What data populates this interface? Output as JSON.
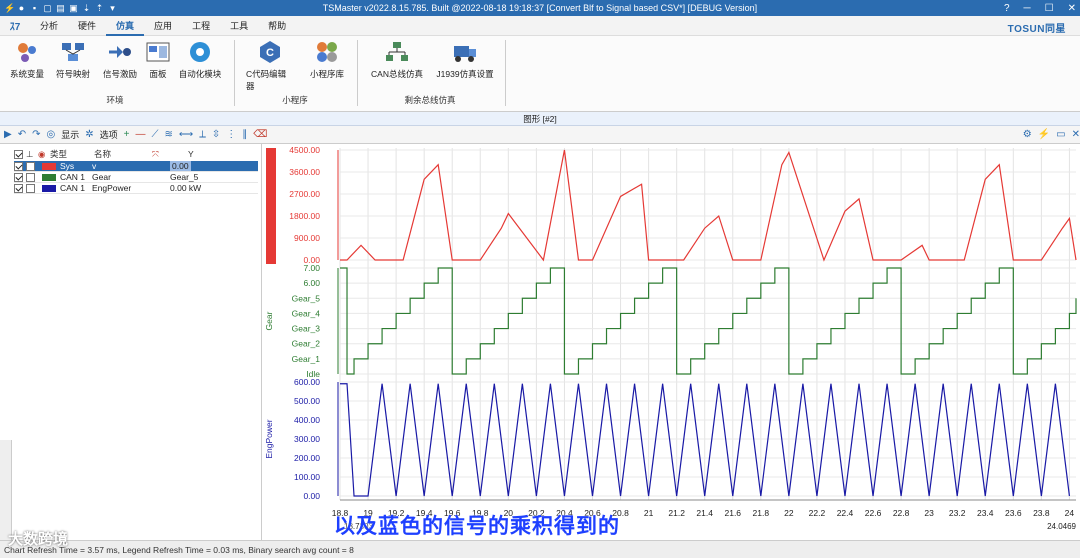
{
  "titlebar": {
    "title": "TSMaster v2022.8.15.785. Built @2022-08-18 19:18:37 [Convert Blf to Signal based CSV*] [DEBUG Version]",
    "min": "─",
    "max": "☐",
    "close": "✕",
    "help": "?"
  },
  "menu": {
    "items": [
      "分析",
      "硬件",
      "仿真",
      "应用",
      "工程",
      "工具",
      "帮助"
    ],
    "active_index": 2,
    "brand": "TOSUN同星"
  },
  "ribbon": {
    "buttons": [
      {
        "label": "系统变量",
        "icon": "system-vars-icon"
      },
      {
        "label": "符号映射",
        "icon": "symbol-map-icon"
      },
      {
        "label": "信号激励",
        "icon": "signal-stimulus-icon"
      },
      {
        "label": "面板",
        "icon": "panel-icon"
      },
      {
        "label": "自动化模块",
        "icon": "automation-icon"
      },
      {
        "label": "C代码编辑器",
        "icon": "c-editor-icon"
      },
      {
        "label": "小程序库",
        "icon": "applet-lib-icon"
      },
      {
        "label": "CAN总线仿真",
        "icon": "can-sim-icon"
      },
      {
        "label": "J1939仿真设置",
        "icon": "j1939-icon"
      }
    ],
    "groups": [
      "环境",
      "小程序",
      "剩余总线仿真"
    ]
  },
  "panel": {
    "title": "图形 [#2]"
  },
  "toolbar": {
    "display": "显示",
    "options": "选项"
  },
  "legend": {
    "headers": {
      "type": "类型",
      "name": "名称",
      "y": "Y"
    },
    "rows": [
      {
        "type": "Sys",
        "name": "v",
        "value": "0.00",
        "color": "#e53935",
        "selected": true
      },
      {
        "type": "CAN 1",
        "name": "Gear",
        "value": "Gear_5",
        "color": "#2e7d32",
        "selected": false
      },
      {
        "type": "CAN 1",
        "name": "EngPower",
        "value": "0.00 kW",
        "color": "#1a1aa6",
        "selected": false
      }
    ]
  },
  "chart_data": {
    "type": "line",
    "x_ticks": [
      "18.8",
      "19",
      "19.2",
      "19.4",
      "19.6",
      "19.8",
      "20",
      "20.2",
      "20.4",
      "20.6",
      "20.8",
      "21",
      "21.2",
      "21.4",
      "21.6",
      "21.8",
      "22",
      "22.2",
      "22.4",
      "22.6",
      "22.8",
      "23",
      "23.2",
      "23.4",
      "23.6",
      "23.8",
      "24"
    ],
    "x_range": [
      18.8,
      24.0469
    ],
    "x_start_label": "18.7303",
    "x_end_label": "24.0469",
    "panels": [
      {
        "name": "v",
        "color": "#e53935",
        "y_ticks": [
          "4500.00",
          "3600.00",
          "2700.00",
          "1800.00",
          "900.00",
          "0.00"
        ],
        "ylim": [
          0,
          4500
        ],
        "x": [
          18.8,
          18.85,
          18.95,
          19.05,
          19.25,
          19.4,
          19.5,
          19.6,
          19.8,
          19.95,
          20.0,
          20.25,
          20.4,
          20.5,
          20.6,
          20.8,
          20.95,
          21.0,
          21.25,
          21.4,
          21.5,
          21.6,
          21.8,
          21.95,
          22.0,
          22.25,
          22.4,
          22.5,
          22.6,
          22.8,
          22.95,
          23.0,
          23.25,
          23.4,
          23.5,
          23.6,
          23.8,
          23.95,
          24.0,
          24.0469
        ],
        "y": [
          0,
          0,
          600,
          0,
          0,
          3300,
          3900,
          0,
          0,
          1300,
          1900,
          0,
          4500,
          0,
          0,
          2600,
          3100,
          0,
          0,
          1300,
          1800,
          0,
          0,
          3900,
          4400,
          0,
          2000,
          2500,
          0,
          0,
          600,
          0,
          0,
          3300,
          3900,
          0,
          0,
          1300,
          1700,
          0
        ]
      },
      {
        "name": "Gear",
        "color": "#2e7d32",
        "y_ticks": [
          "7.00",
          "6.00",
          "Gear_5",
          "Gear_4",
          "Gear_3",
          "Gear_2",
          "Gear_1",
          "Idle"
        ],
        "ylim": [
          0,
          7
        ],
        "x": [
          18.8,
          18.85,
          18.9,
          19.0,
          19.1,
          19.2,
          19.3,
          19.4,
          19.5,
          19.6,
          19.7,
          19.8,
          19.9,
          20.0,
          20.1,
          20.2,
          20.3,
          20.4,
          20.5,
          20.6,
          20.7,
          20.8,
          20.9,
          21.0,
          21.1,
          21.2,
          21.3,
          21.4,
          21.5,
          21.6,
          21.7,
          21.8,
          21.9,
          22.0,
          22.1,
          22.2,
          22.3,
          22.4,
          22.5,
          22.6,
          22.7,
          22.8,
          22.9,
          23.0,
          23.1,
          23.2,
          23.3,
          23.4,
          23.5,
          23.6,
          23.7,
          23.8,
          23.9,
          24.0,
          24.0469
        ],
        "y": [
          7,
          0,
          1,
          2,
          3,
          4,
          5,
          6,
          7,
          0,
          1,
          2,
          3,
          4,
          5,
          6,
          7,
          0,
          1,
          2,
          3,
          4,
          5,
          6,
          7,
          0,
          1,
          2,
          3,
          4,
          5,
          6,
          7,
          0,
          1,
          2,
          3,
          4,
          5,
          6,
          7,
          0,
          1,
          2,
          3,
          4,
          5,
          6,
          7,
          0,
          1,
          2,
          3,
          4,
          5
        ]
      },
      {
        "name": "EngPower",
        "color": "#1a1aa6",
        "y_ticks": [
          "600.00",
          "500.00",
          "400.00",
          "300.00",
          "200.00",
          "100.00",
          "0.00"
        ],
        "ylim": [
          0,
          650
        ],
        "x": [
          18.8,
          18.85,
          18.9,
          19.0,
          19.1,
          19.2,
          19.3,
          19.4,
          19.5,
          19.6,
          19.7,
          19.8,
          19.9,
          20.0,
          20.1,
          20.2,
          20.3,
          20.4,
          20.5,
          20.6,
          20.7,
          20.8,
          20.9,
          21.0,
          21.1,
          21.2,
          21.3,
          21.4,
          21.5,
          21.6,
          21.7,
          21.8,
          21.9,
          22.0,
          22.1,
          22.2,
          22.3,
          22.4,
          22.5,
          22.6,
          22.7,
          22.8,
          22.9,
          23.0,
          23.1,
          23.2,
          23.3,
          23.4,
          23.5,
          23.6,
          23.7,
          23.8,
          23.9,
          24.0
        ],
        "y": [
          640,
          640,
          0,
          0,
          640,
          0,
          640,
          0,
          640,
          0,
          640,
          0,
          640,
          0,
          640,
          0,
          640,
          0,
          640,
          0,
          640,
          0,
          640,
          0,
          640,
          0,
          640,
          0,
          640,
          0,
          640,
          0,
          640,
          0,
          640,
          0,
          640,
          0,
          640,
          0,
          640,
          0,
          640,
          0,
          640,
          0,
          640,
          0,
          640,
          0,
          640,
          0,
          640,
          0
        ]
      }
    ]
  },
  "status": {
    "text": "Chart Refresh Time = 3.57 ms, Legend Refresh Time = 0.03 ms, Binary search avg count = 8"
  },
  "subtitle": "以及蓝色的信号的乘积得到的",
  "watermark": "大数跨境"
}
